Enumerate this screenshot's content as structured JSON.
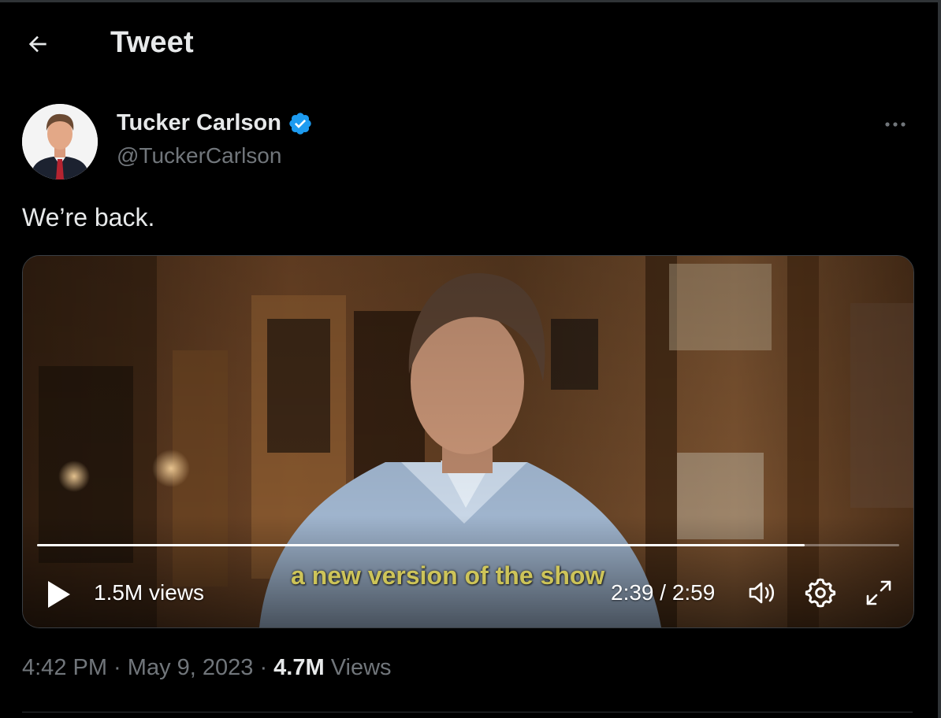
{
  "header": {
    "title": "Tweet",
    "back_icon": "arrow-left-icon"
  },
  "author": {
    "display_name": "Tucker Carlson",
    "handle": "@TuckerCarlson",
    "verified_color": "#1d9bf0"
  },
  "tweet": {
    "text": "We’re back."
  },
  "video": {
    "views_label": "1.5M views",
    "time_label": "2:39 / 2:59",
    "subtitle": "a new version of the show",
    "progress_fraction": 0.89
  },
  "meta": {
    "time": "4:42 PM",
    "separator": " · ",
    "date": "May 9, 2023",
    "views_count": "4.7M",
    "views_word": " Views"
  },
  "colors": {
    "background": "#000000",
    "text_primary": "#e7e9ea",
    "text_secondary": "#71767b",
    "accent": "#1d9bf0"
  }
}
